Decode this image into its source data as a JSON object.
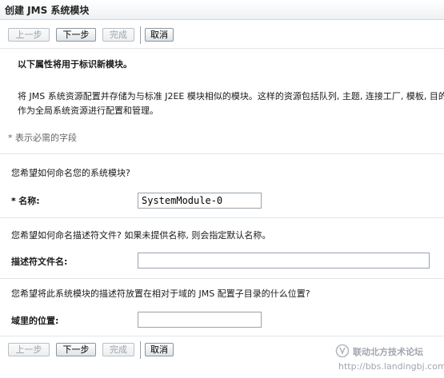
{
  "window": {
    "title": "创建 JMS 系统模块"
  },
  "toolbar": {
    "back_label": "上一步",
    "next_label": "下一步",
    "finish_label": "完成",
    "cancel_label": "取消"
  },
  "intro": {
    "heading": "以下属性将用于标识新模块。",
    "description_line1": "将 JMS 系统资源配置并存储为与标准 J2EE 模块相似的模块。这样的资源包括队列, 主题, 连接工厂, 模板, 目的",
    "description_line2": "作为全局系统资源进行配置和管理。",
    "required_note": "* 表示必需的字段"
  },
  "name_section": {
    "question": "您希望如何命名您的系统模块?",
    "star": "*",
    "label": "名称:",
    "value": "SystemModule-0"
  },
  "descriptor_section": {
    "question": "您希望如何命名描述符文件? 如果未提供名称, 则会指定默认名称。",
    "label": "描述符文件名:",
    "value": ""
  },
  "location_section": {
    "question": "您希望将此系统模块的描述符放置在相对于域的 JMS 配置子目录的什么位置?",
    "label": "域里的位置:",
    "value": ""
  },
  "watermark": {
    "title": "联动北方技术论坛",
    "url": "http://bbs.landingbj.com"
  }
}
